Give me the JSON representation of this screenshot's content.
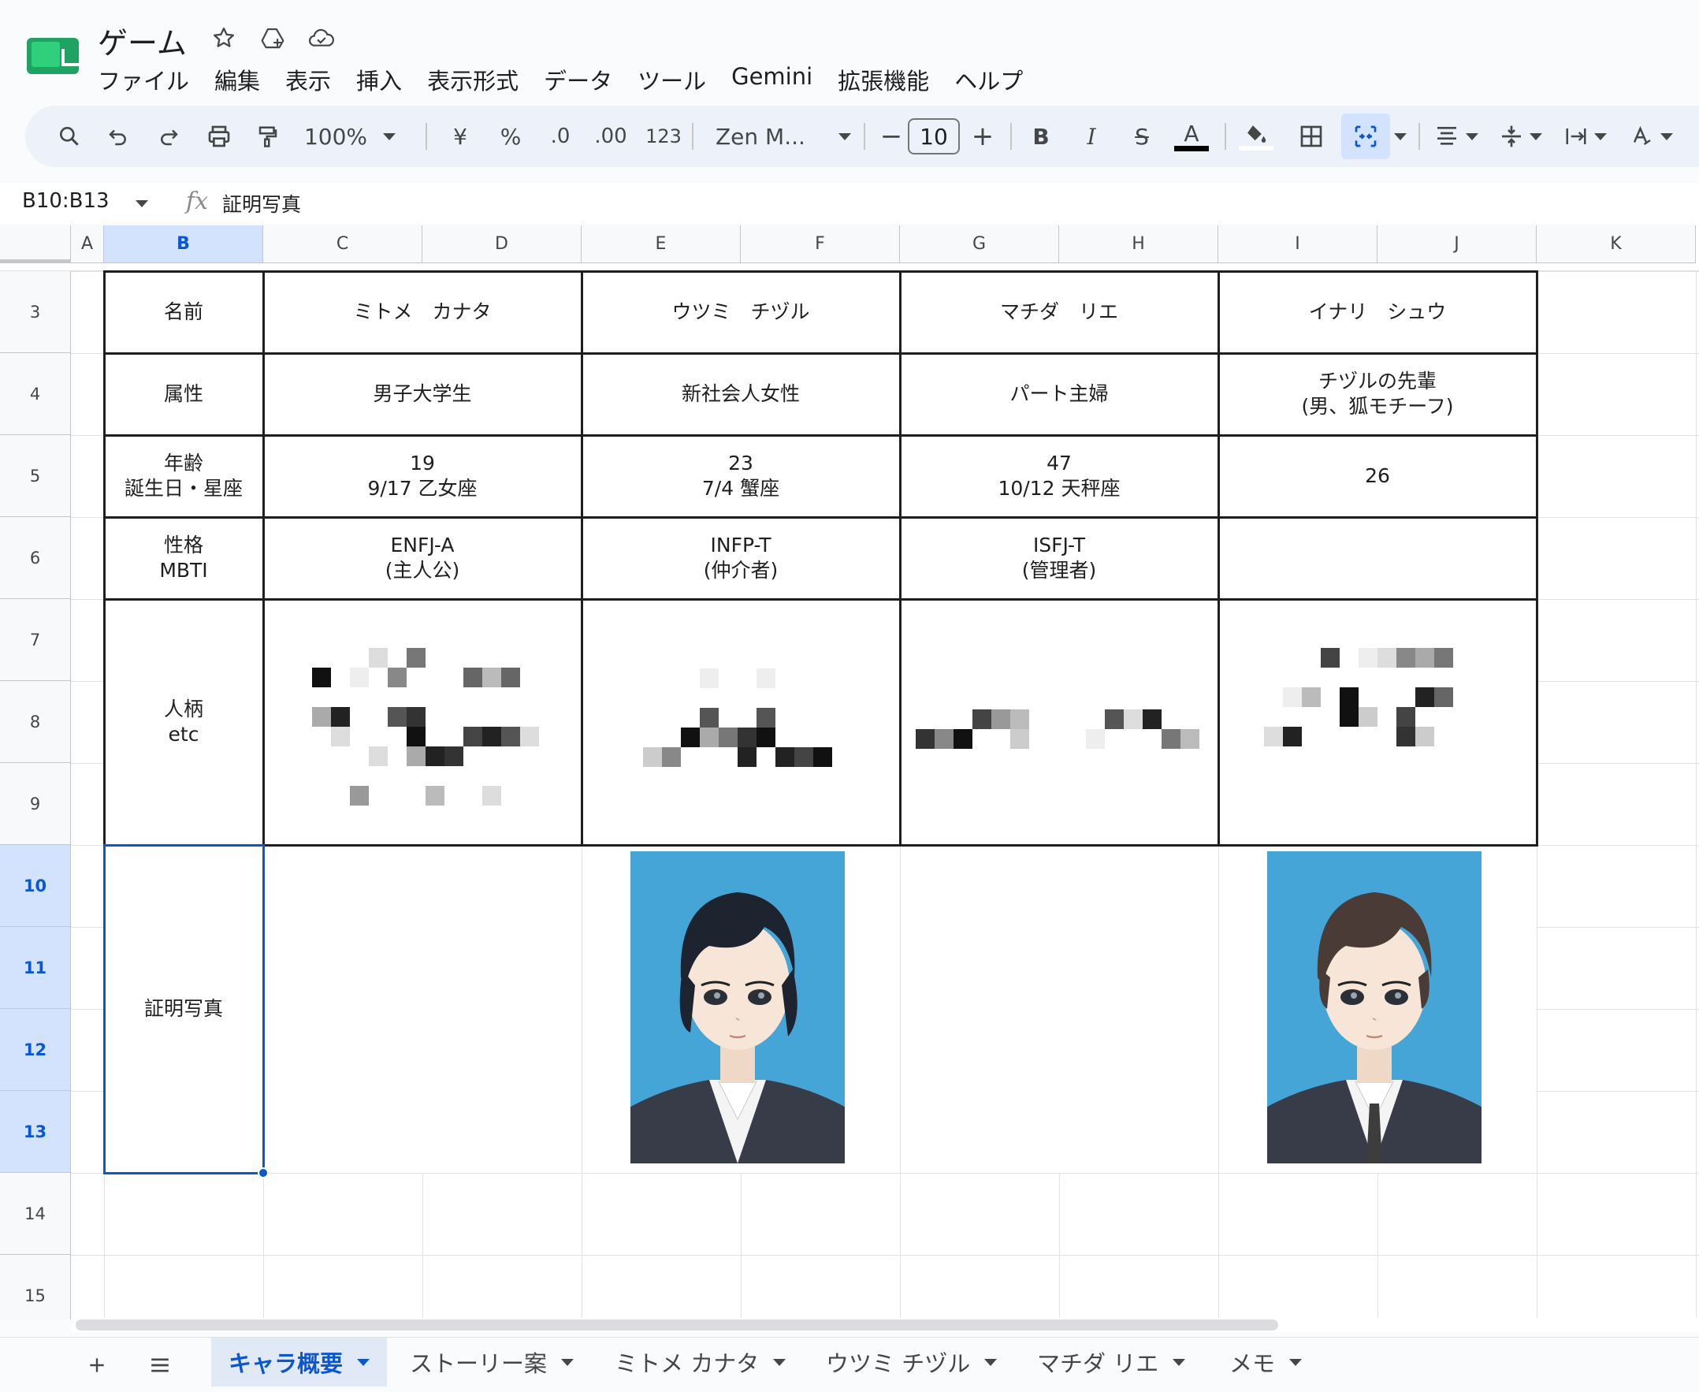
{
  "doc": {
    "title": "ゲーム",
    "title_icons": [
      "star-icon",
      "move-to-drive-icon",
      "cloud-status-icon"
    ],
    "menu": [
      "ファイル",
      "編集",
      "表示",
      "挿入",
      "表示形式",
      "データ",
      "ツール",
      "Gemini",
      "拡張機能",
      "ヘルプ"
    ]
  },
  "toolbar": {
    "zoom": "100%",
    "currency": "¥",
    "percent": "%",
    "dec_decrease": ".0",
    "dec_increase": ".00",
    "number_format": "123",
    "font": "Zen M...",
    "font_size": "10",
    "minus": "−",
    "plus": "+",
    "bold": "B",
    "italic": "I",
    "strike": "S",
    "text_color_letter": "A",
    "text_color": "#000000"
  },
  "formula_bar": {
    "name_box": "B10:B13",
    "fx": "fx",
    "value": "証明写真"
  },
  "columns": [
    "A",
    "B",
    "C",
    "D",
    "E",
    "F",
    "G",
    "H",
    "I",
    "J",
    "K"
  ],
  "selected_column": "B",
  "rows": [
    "3",
    "4",
    "5",
    "6",
    "7",
    "8",
    "9",
    "10",
    "11",
    "12",
    "13",
    "14",
    "15"
  ],
  "selected_rows": [
    "10",
    "11",
    "12",
    "13"
  ],
  "table": {
    "labels": {
      "name": "名前",
      "attribute": "属性",
      "age": "年齢\n誕生日・星座",
      "personality": "性格\nMBTI",
      "character": "人柄\netc",
      "photo": "証明写真"
    },
    "characters": [
      {
        "name": "ミトメ　カナタ",
        "attribute": "男子大学生",
        "age": "19\n9/17 乙女座",
        "mbti": "ENFJ-A\n(主人公)",
        "has_photo": false
      },
      {
        "name": "ウツミ　チヅル",
        "attribute": "新社会人女性",
        "age": "23\n7/4 蟹座",
        "mbti": "INFP-T\n(仲介者)",
        "has_photo": true
      },
      {
        "name": "マチダ　リエ",
        "attribute": "パート主婦",
        "age": "47\n10/12 天秤座",
        "mbti": "ISFJ-T\n(管理者)",
        "has_photo": false
      },
      {
        "name": "イナリ　シュウ",
        "attribute": "チヅルの先輩\n(男、狐モチーフ)",
        "age": "26",
        "mbti": "",
        "has_photo": true
      }
    ]
  },
  "sheet_tabs": [
    {
      "label": "キャラ概要",
      "active": true
    },
    {
      "label": "ストーリー案",
      "active": false
    },
    {
      "label": "ミトメ カナタ",
      "active": false
    },
    {
      "label": "ウツミ チヅル",
      "active": false
    },
    {
      "label": "マチダ リエ",
      "active": false
    },
    {
      "label": "メモ",
      "active": false
    }
  ],
  "colors": {
    "accent": "#0b57d0",
    "selection_bg": "#d3e3fd",
    "photo_bg": "#45a5d7",
    "sheets_green": "#1ea362"
  }
}
